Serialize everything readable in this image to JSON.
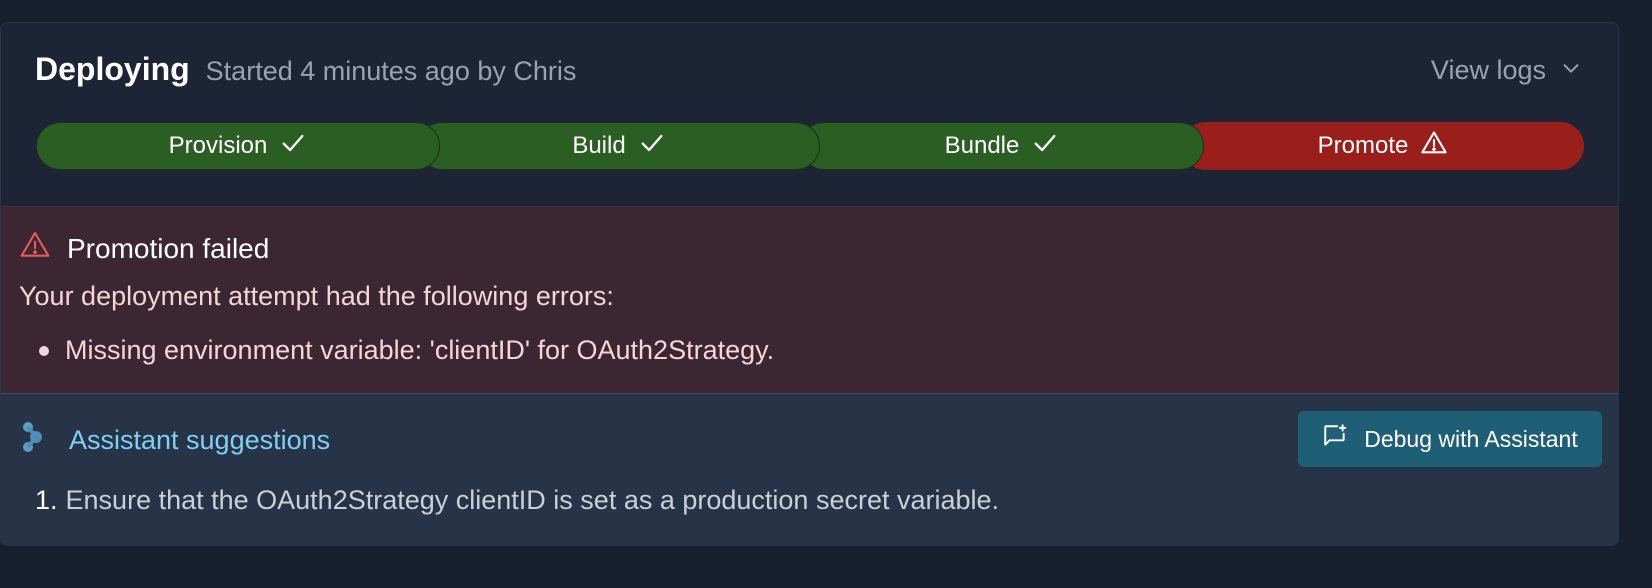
{
  "deploy": {
    "status": "Deploying",
    "started": "Started 4 minutes ago by Chris",
    "view_logs": "View logs"
  },
  "pipeline": {
    "stages": [
      {
        "label": "Provision",
        "state": "done",
        "icon": "check-icon"
      },
      {
        "label": "Build",
        "state": "done",
        "icon": "check-icon"
      },
      {
        "label": "Bundle",
        "state": "done",
        "icon": "check-icon"
      },
      {
        "label": "Promote",
        "state": "failed",
        "icon": "warning-icon"
      }
    ],
    "colors": {
      "done": "#2b5e22",
      "failed": "#9a1f1a"
    }
  },
  "error": {
    "title": "Promotion failed",
    "intro": "Your deployment attempt had the following errors:",
    "items": [
      "Missing environment variable: 'clientID' for OAuth2Strategy."
    ]
  },
  "assistant": {
    "title": "Assistant suggestions",
    "debug_button": "Debug with Assistant",
    "suggestions": [
      {
        "number": "1.",
        "text": "Ensure that the OAuth2Strategy clientID is set as a production secret variable."
      }
    ]
  }
}
